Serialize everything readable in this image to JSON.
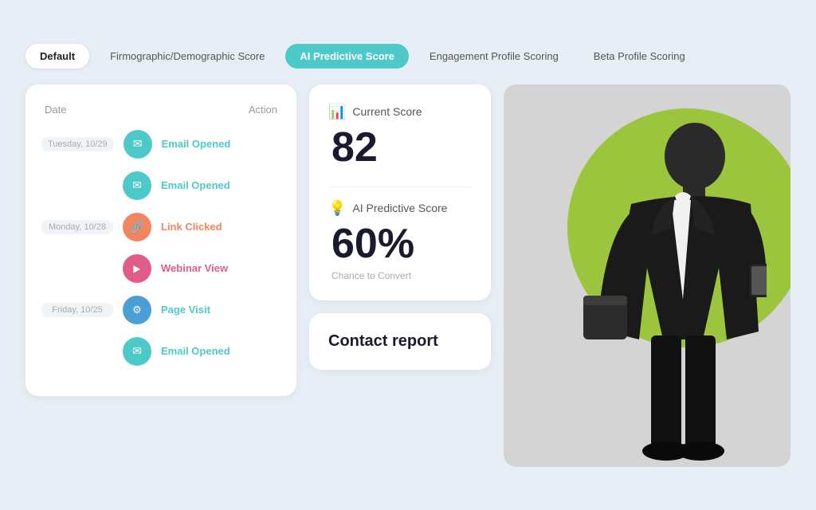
{
  "tabs": [
    {
      "id": "default",
      "label": "Default",
      "state": "active-default"
    },
    {
      "id": "firmographic",
      "label": "Firmographic/Demographic Score",
      "state": ""
    },
    {
      "id": "ai-predictive",
      "label": "AI Predictive Score",
      "state": "active-ai"
    },
    {
      "id": "engagement",
      "label": "Engagement Profile Scoring",
      "state": ""
    },
    {
      "id": "beta",
      "label": "Beta Profile Scoring",
      "state": ""
    }
  ],
  "activity": {
    "col_date": "Date",
    "col_action": "Action",
    "rows": [
      {
        "date": "Tuesday, 10/29",
        "show_date": true,
        "icon_class": "icon-teal",
        "icon": "✉",
        "action": "Email Opened",
        "action_color": "teal"
      },
      {
        "date": "",
        "show_date": false,
        "icon_class": "icon-teal",
        "icon": "✉",
        "action": "Email Opened",
        "action_color": "teal"
      },
      {
        "date": "Monday, 10/28",
        "show_date": true,
        "icon_class": "icon-orange",
        "icon": "🔗",
        "action": "Link Clicked",
        "action_color": "orange"
      },
      {
        "date": "",
        "show_date": false,
        "icon_class": "icon-pink",
        "icon": "▶",
        "action": "Webinar View",
        "action_color": "pink"
      },
      {
        "date": "Friday, 10/25",
        "show_date": true,
        "icon_class": "icon-blue",
        "icon": "⚙",
        "action": "Page Visit",
        "action_color": "teal"
      },
      {
        "date": "",
        "show_date": false,
        "icon_class": "icon-teal",
        "icon": "✉",
        "action": "Email Opened",
        "action_color": "teal"
      }
    ]
  },
  "scores": {
    "current_score_label": "Current Score",
    "current_score_value": "82",
    "ai_predictive_label": "AI Predictive Score",
    "ai_predictive_value": "60%",
    "chance_to_convert": "Chance to Convert"
  },
  "contact_report": {
    "label": "Contact report"
  },
  "colors": {
    "teal": "#4dc9c9",
    "orange": "#f4845f",
    "pink": "#e05c8a",
    "blue": "#4a9fd4",
    "green_circle": "#9bc53d"
  }
}
